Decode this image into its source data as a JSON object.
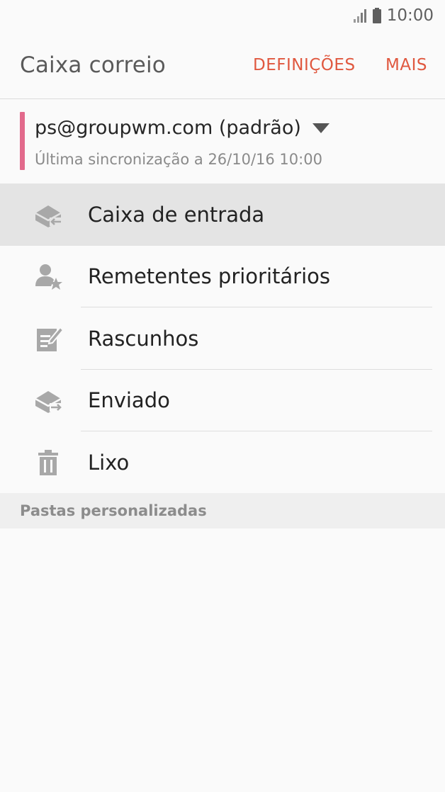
{
  "status_bar": {
    "time": "10:00",
    "icons": [
      "signal-icon",
      "battery-icon"
    ]
  },
  "app_bar": {
    "title": "Caixa correio",
    "actions": {
      "settings": "DEFINIÇÕES",
      "more": "MAIS"
    }
  },
  "account": {
    "email": "ps@groupwm.com (padrão)",
    "last_sync": "Última sincronização a 26/10/16  10:00",
    "accent_color": "#e26a8c"
  },
  "folders": [
    {
      "label": "Caixa de entrada",
      "icon": "inbox-icon",
      "selected": true
    },
    {
      "label": "Remetentes prioritários",
      "icon": "priority-sender-icon",
      "selected": false
    },
    {
      "label": "Rascunhos",
      "icon": "drafts-icon",
      "selected": false
    },
    {
      "label": "Enviado",
      "icon": "sent-icon",
      "selected": false
    },
    {
      "label": "Lixo",
      "icon": "trash-icon",
      "selected": false
    }
  ],
  "sections": {
    "custom_folders": "Pastas personalizadas"
  },
  "colors": {
    "accent": "#e0583f",
    "icon": "#a8a8a8",
    "selected_row": "#e4e4e4"
  }
}
